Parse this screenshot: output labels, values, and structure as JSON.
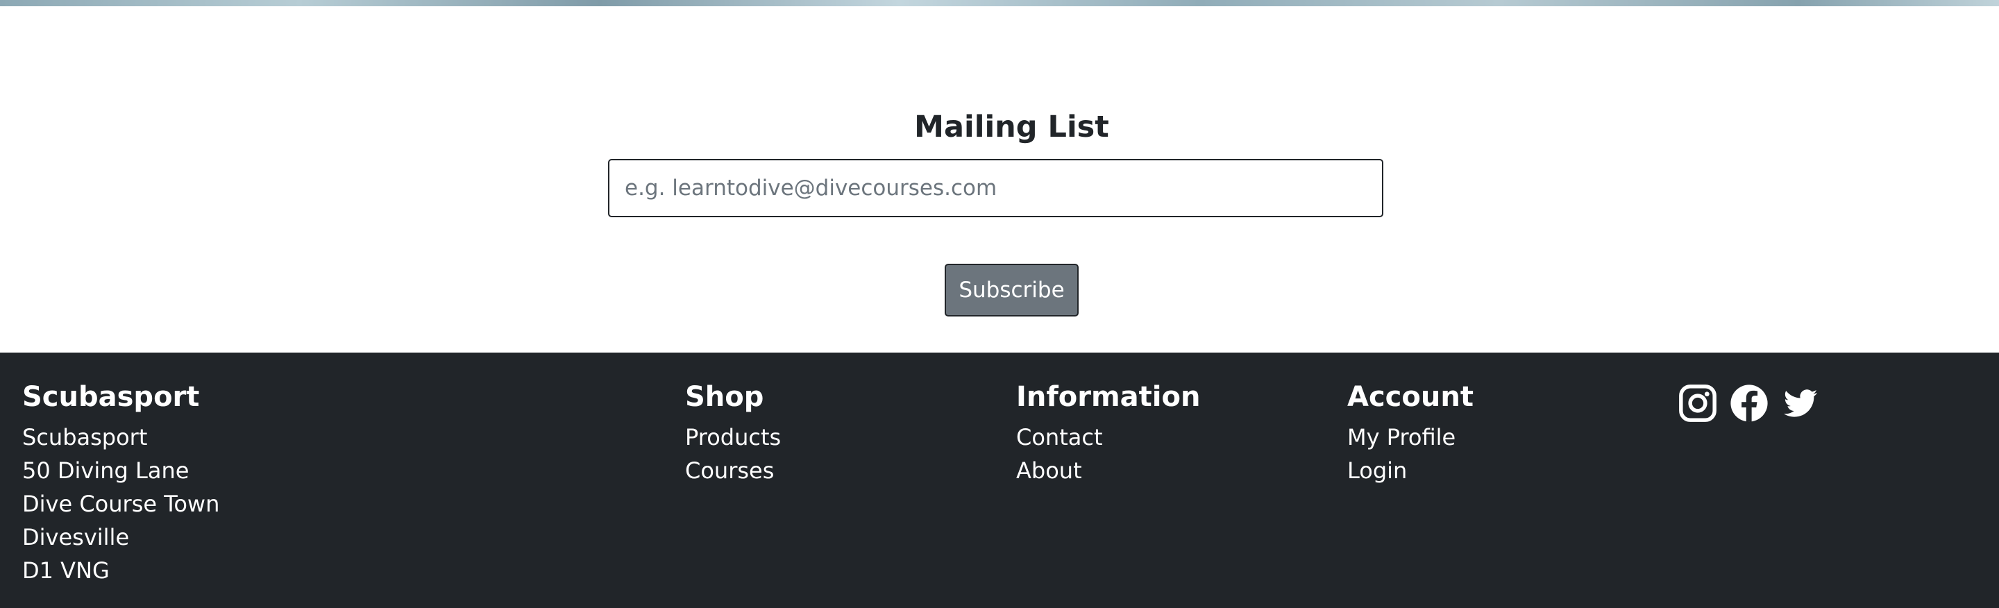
{
  "mailing": {
    "title": "Mailing List",
    "email_placeholder": "e.g. learntodive@divecourses.com",
    "email_value": "",
    "subscribe_label": "Subscribe"
  },
  "footer": {
    "brand": {
      "heading": "Scubasport",
      "address": [
        "Scubasport",
        "50 Diving Lane",
        "Dive Course Town",
        "Divesville",
        "D1 VNG"
      ]
    },
    "shop": {
      "heading": "Shop",
      "links": [
        "Products",
        "Courses"
      ]
    },
    "information": {
      "heading": "Information",
      "links": [
        "Contact",
        "About"
      ]
    },
    "account": {
      "heading": "Account",
      "links": [
        "My Profile",
        "Login"
      ]
    },
    "social": [
      {
        "icon": "instagram-icon"
      },
      {
        "icon": "facebook-icon"
      },
      {
        "icon": "twitter-icon"
      }
    ]
  },
  "colors": {
    "footer_bg": "#212529",
    "button_bg": "#6c757d",
    "text_dark": "#212529",
    "placeholder": "#6c757d"
  }
}
